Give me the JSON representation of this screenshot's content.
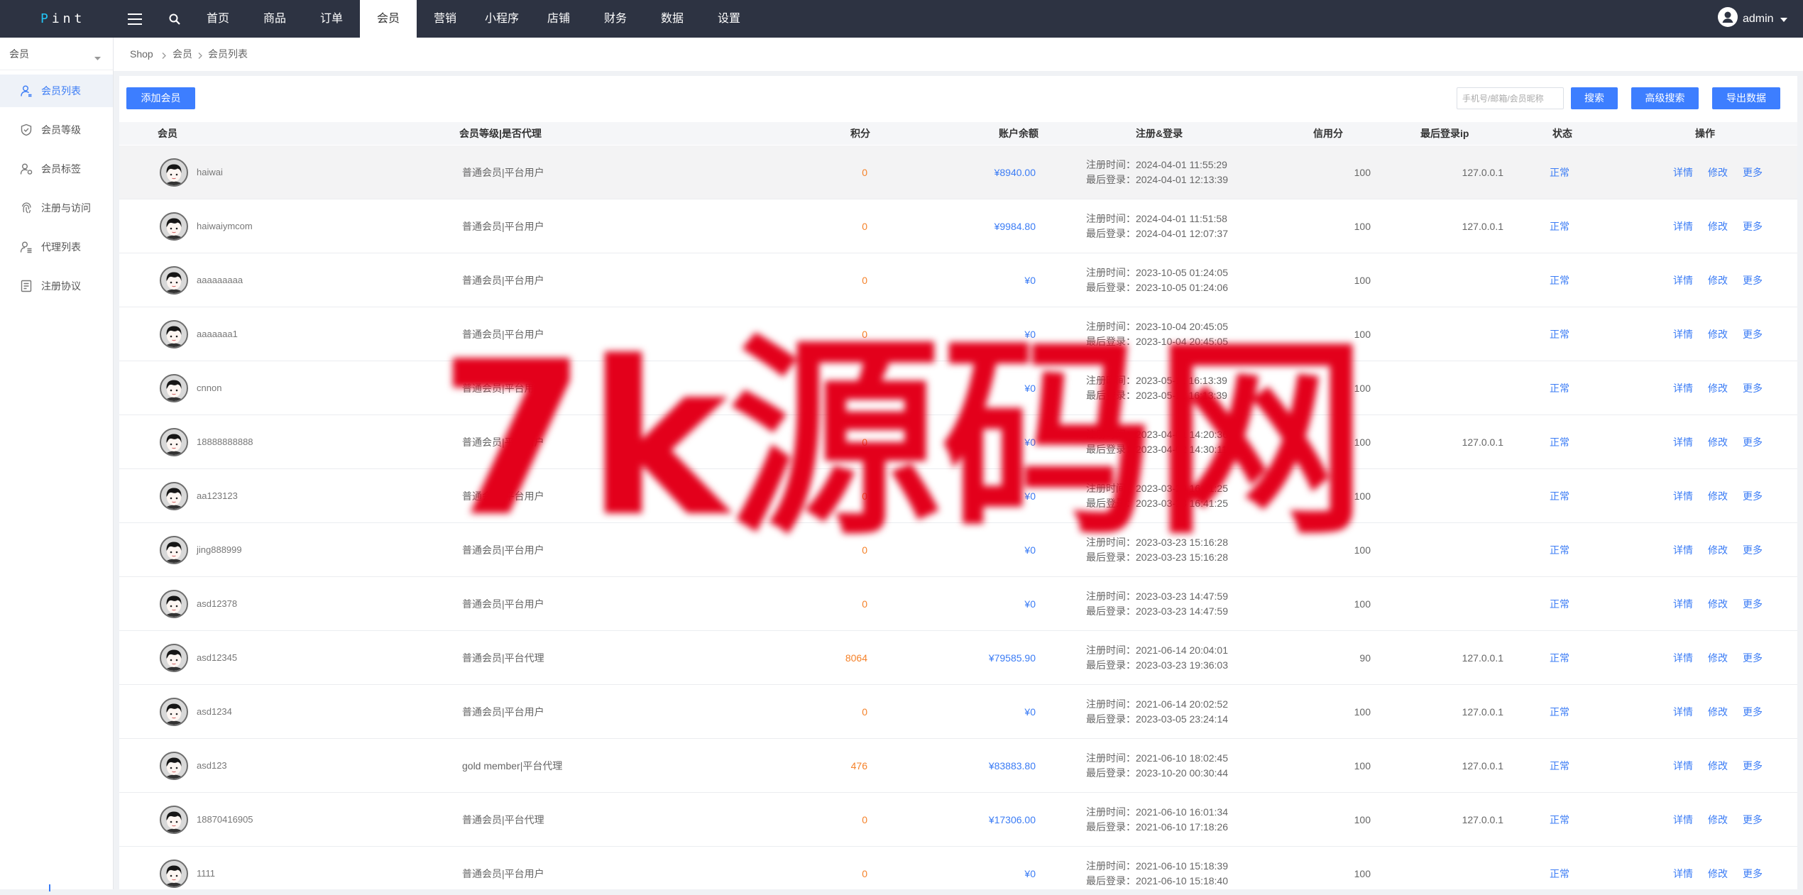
{
  "colors": {
    "nav_bg": "#2d3342",
    "accent": "#3b7cf5",
    "button": "#3d7eff",
    "points": "#f5822a",
    "watermark": "#e3001b"
  },
  "logo": {
    "first": "P",
    "rest": "int"
  },
  "nav": {
    "items": [
      "首页",
      "商品",
      "订单",
      "会员",
      "营销",
      "小程序",
      "店铺",
      "财务",
      "数据",
      "设置"
    ],
    "active_index": 3,
    "user": "admin",
    "icons": [
      "menu-icon",
      "search-icon",
      "user-avatar-icon",
      "chevron-down-icon"
    ]
  },
  "sidebar": {
    "section": "会员",
    "active_index": 0,
    "items": [
      {
        "label": "会员列表",
        "icon": "user-icon"
      },
      {
        "label": "会员等级",
        "icon": "shield-icon"
      },
      {
        "label": "会员标签",
        "icon": "user-tag-icon"
      },
      {
        "label": "注册与访问",
        "icon": "fingerprint-icon"
      },
      {
        "label": "代理列表",
        "icon": "user-list-icon"
      },
      {
        "label": "注册协议",
        "icon": "document-icon"
      }
    ]
  },
  "breadcrumb": [
    "Shop",
    "会员",
    "会员列表"
  ],
  "toolbar": {
    "add_label": "添加会员",
    "search_placeholder": "手机号/邮箱/会员昵称",
    "search_label": "搜索",
    "advanced_label": "高级搜索",
    "export_label": "导出数据"
  },
  "table": {
    "headers": {
      "member": "会员",
      "level": "会员等级|是否代理",
      "points": "积分",
      "balance": "账户余额",
      "reg_login": "注册&登录",
      "credit": "信用分",
      "last_ip": "最后登录ip",
      "status": "状态",
      "actions": "操作"
    },
    "highlighted_row": 0,
    "rows": [
      {
        "username": "haiwai",
        "level": "普通会员|平台用户",
        "points": "0",
        "balance": "¥8940.00",
        "register": "注册时间：2024-04-01 11:55:29",
        "last_login": "最后登录：2024-04-01 12:13:39",
        "credit": "100",
        "ip": "127.0.0.1",
        "status": "正常"
      },
      {
        "username": "haiwaiymcom",
        "level": "普通会员|平台用户",
        "points": "0",
        "balance": "¥9984.80",
        "register": "注册时间：2024-04-01 11:51:58",
        "last_login": "最后登录：2024-04-01 12:07:37",
        "credit": "100",
        "ip": "127.0.0.1",
        "status": "正常"
      },
      {
        "username": "aaaaaaaaa",
        "level": "普通会员|平台用户",
        "points": "0",
        "balance": "¥0",
        "register": "注册时间：2023-10-05 01:24:05",
        "last_login": "最后登录：2023-10-05 01:24:06",
        "credit": "100",
        "status": "正常"
      },
      {
        "username": "aaaaaaa1",
        "level": "普通会员|平台用户",
        "points": "0",
        "balance": "¥0",
        "register": "注册时间：2023-10-04 20:45:05",
        "last_login": "最后登录：2023-10-04 20:45:05",
        "credit": "100",
        "status": "正常"
      },
      {
        "username": "cnnon",
        "level": "普通会员|平台用户",
        "points": "0",
        "balance": "¥0",
        "register": "注册时间：2023-05-11 16:13:39",
        "last_login": "最后登录：2023-05-11 16:13:39",
        "credit": "100",
        "status": "正常"
      },
      {
        "username": "18888888888",
        "level": "普通会员|平台用户",
        "points": "0",
        "balance": "¥0",
        "register": "注册时间：2023-04-01 14:20:36",
        "last_login": "最后登录：2023-04-02 14:30:11",
        "credit": "100",
        "ip": "127.0.0.1",
        "status": "正常"
      },
      {
        "username": "aa123123",
        "level": "普通会员|平台用户",
        "points": "0",
        "balance": "¥0",
        "register": "注册时间：2023-03-23 16:41:25",
        "last_login": "最后登录：2023-03-23 16:41:25",
        "credit": "100",
        "status": "正常"
      },
      {
        "username": "jing888999",
        "level": "普通会员|平台用户",
        "points": "0",
        "balance": "¥0",
        "register": "注册时间：2023-03-23 15:16:28",
        "last_login": "最后登录：2023-03-23 15:16:28",
        "credit": "100",
        "status": "正常"
      },
      {
        "username": "asd12378",
        "level": "普通会员|平台用户",
        "points": "0",
        "balance": "¥0",
        "register": "注册时间：2023-03-23 14:47:59",
        "last_login": "最后登录：2023-03-23 14:47:59",
        "credit": "100",
        "status": "正常"
      },
      {
        "username": "asd12345",
        "level": "普通会员|平台代理",
        "points": "8064",
        "balance": "¥79585.90",
        "register": "注册时间：2021-06-14 20:04:01",
        "last_login": "最后登录：2023-03-23 19:36:03",
        "credit": "90",
        "ip": "127.0.0.1",
        "status": "正常"
      },
      {
        "username": "asd1234",
        "level": "普通会员|平台用户",
        "points": "0",
        "balance": "¥0",
        "register": "注册时间：2021-06-14 20:02:52",
        "last_login": "最后登录：2023-03-05 23:24:14",
        "credit": "100",
        "ip": "127.0.0.1",
        "status": "正常"
      },
      {
        "username": "asd123",
        "level": "gold member|平台代理",
        "points": "476",
        "balance": "¥83883.80",
        "register": "注册时间：2021-06-10 18:02:45",
        "last_login": "最后登录：2023-10-20 00:30:44",
        "credit": "100",
        "ip": "127.0.0.1",
        "status": "正常"
      },
      {
        "username": "18870416905",
        "level": "普通会员|平台代理",
        "points": "0",
        "balance": "¥17306.00",
        "register": "注册时间：2021-06-10 16:01:34",
        "last_login": "最后登录：2021-06-10 17:18:26",
        "credit": "100",
        "ip": "127.0.0.1",
        "status": "正常"
      },
      {
        "username": "1111",
        "level": "普通会员|平台用户",
        "points": "0",
        "balance": "¥0",
        "register": "注册时间：2021-06-10 15:18:39",
        "last_login": "最后登录：2021-06-10 15:18:40",
        "credit": "100",
        "status": "正常"
      }
    ]
  },
  "actions": {
    "detail": "详情",
    "edit": "修改",
    "more": "更多"
  },
  "watermark": {
    "text": "7k源码网"
  }
}
